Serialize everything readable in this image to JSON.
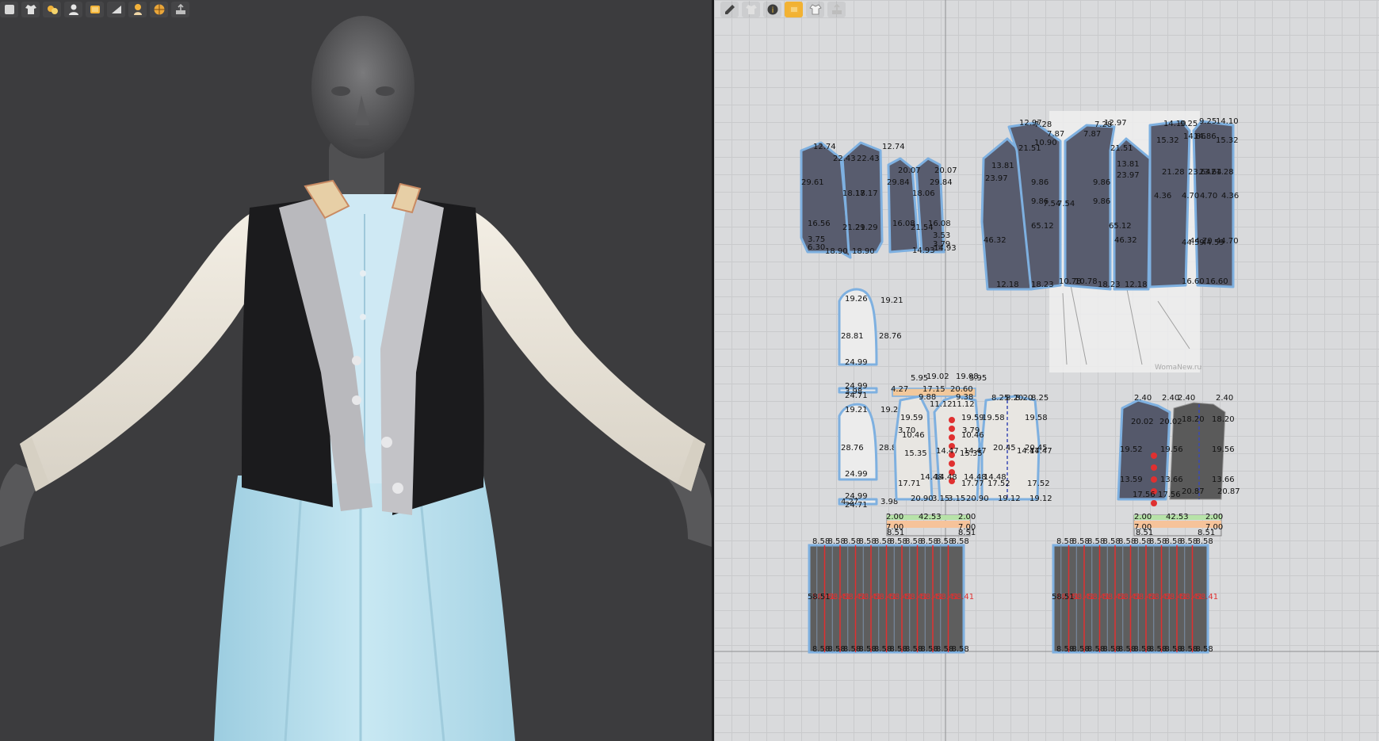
{
  "left_toolbar": {
    "icons": [
      "avatar-frame-icon",
      "garment-icon",
      "fabric-swatch-icon",
      "avatar-icon",
      "texture-icon",
      "fold-icon",
      "figure-icon",
      "globe-icon",
      "export-icon"
    ]
  },
  "right_toolbar": {
    "icons": [
      "edit-pattern-icon",
      "garment-icon",
      "pattern-info-icon",
      "texture-icon",
      "shirt-icon",
      "export-icon"
    ],
    "active_index": 3
  },
  "colors": {
    "viewport_bg": "#3c3c3e",
    "pattern_bg": "#d9dadc",
    "vest_fill": "#585c6e",
    "vest_outline": "#7eb0e0",
    "shirt_fill": "#e8e6e2",
    "skirt_fill": "#5e5e5e",
    "seam_red": "#e03030",
    "skirt_3d": "#bfe2ef",
    "sleeve_3d": "#ece7dc",
    "vest_3d": "#1c1c1e"
  },
  "patterns": {
    "back_vest_labels": [
      {
        "text": "12.74"
      },
      {
        "text": "12.74"
      },
      {
        "text": "22.43"
      },
      {
        "text": "22.43"
      },
      {
        "text": "29.61"
      },
      {
        "text": "18.17"
      },
      {
        "text": "18.17"
      },
      {
        "text": "16.56"
      },
      {
        "text": "21.29"
      },
      {
        "text": "21.29"
      },
      {
        "text": "3.75"
      },
      {
        "text": "6.30"
      },
      {
        "text": "18.90"
      },
      {
        "text": "18.90"
      },
      {
        "text": "20.07"
      },
      {
        "text": "20.07"
      },
      {
        "text": "29.84"
      },
      {
        "text": "29.84"
      },
      {
        "text": "18.06"
      },
      {
        "text": "16.08"
      },
      {
        "text": "16.08"
      },
      {
        "text": "21.54"
      },
      {
        "text": "3.53"
      },
      {
        "text": "3.79"
      },
      {
        "text": "14.93"
      },
      {
        "text": "14.93"
      }
    ],
    "front_vest_labels": [
      {
        "text": "12.97"
      },
      {
        "text": "7.28"
      },
      {
        "text": "7.87"
      },
      {
        "text": "10.90"
      },
      {
        "text": "7.87"
      },
      {
        "text": "7.28"
      },
      {
        "text": "12.97"
      },
      {
        "text": "21.51"
      },
      {
        "text": "21.51"
      },
      {
        "text": "13.81"
      },
      {
        "text": "13.81"
      },
      {
        "text": "23.97"
      },
      {
        "text": "23.97"
      },
      {
        "text": "9.86"
      },
      {
        "text": "9.86"
      },
      {
        "text": "9.86"
      },
      {
        "text": "9.86"
      },
      {
        "text": "7.54"
      },
      {
        "text": "7.54"
      },
      {
        "text": "65.12"
      },
      {
        "text": "65.12"
      },
      {
        "text": "46.32"
      },
      {
        "text": "46.32"
      },
      {
        "text": "12.18"
      },
      {
        "text": "18.23"
      },
      {
        "text": "10.78"
      },
      {
        "text": "10.78"
      },
      {
        "text": "18.23"
      },
      {
        "text": "12.18"
      }
    ],
    "side_vest_labels": [
      {
        "text": "14.10"
      },
      {
        "text": "9.25"
      },
      {
        "text": "9.25"
      },
      {
        "text": "14.10"
      },
      {
        "text": "15.32"
      },
      {
        "text": "14.86"
      },
      {
        "text": "14.86"
      },
      {
        "text": "15.32"
      },
      {
        "text": "23.64"
      },
      {
        "text": "23.64"
      },
      {
        "text": "21.28"
      },
      {
        "text": "21.28"
      },
      {
        "text": "4.36"
      },
      {
        "text": "4.70"
      },
      {
        "text": "4.70"
      },
      {
        "text": "4.36"
      },
      {
        "text": "44.70"
      },
      {
        "text": "44.59"
      },
      {
        "text": "44.59"
      },
      {
        "text": "44.70"
      },
      {
        "text": "16.60"
      },
      {
        "text": "16.60"
      }
    ],
    "sleeve_labels": [
      {
        "text": "19.26"
      },
      {
        "text": "19.21"
      },
      {
        "text": "28.81"
      },
      {
        "text": "28.76"
      },
      {
        "text": "24.99"
      },
      {
        "text": "3.98"
      },
      {
        "text": "24.99"
      },
      {
        "text": "24.71"
      },
      {
        "text": "19.21"
      },
      {
        "text": "19.26"
      },
      {
        "text": "28.76"
      },
      {
        "text": "28.81"
      },
      {
        "text": "24.99"
      },
      {
        "text": "4.27"
      },
      {
        "text": "24.99"
      },
      {
        "text": "24.71"
      },
      {
        "text": "3.98"
      }
    ],
    "shirt_labels": [
      {
        "text": "5.95"
      },
      {
        "text": "19.02"
      },
      {
        "text": "19.08"
      },
      {
        "text": "5.95"
      },
      {
        "text": "4.27"
      },
      {
        "text": "17.15"
      },
      {
        "text": "20.60"
      },
      {
        "text": "9.88"
      },
      {
        "text": "9.38"
      },
      {
        "text": "11.12"
      },
      {
        "text": "11.12"
      },
      {
        "text": "19.59"
      },
      {
        "text": "19.59"
      },
      {
        "text": "19.58"
      },
      {
        "text": "19.58"
      },
      {
        "text": "8.25"
      },
      {
        "text": "8.25"
      },
      {
        "text": "8.20"
      },
      {
        "text": "8.20"
      },
      {
        "text": "3.70"
      },
      {
        "text": "3.79"
      },
      {
        "text": "10.46"
      },
      {
        "text": "10.46"
      },
      {
        "text": "15.35"
      },
      {
        "text": "15.35"
      },
      {
        "text": "20.45"
      },
      {
        "text": "20.45"
      },
      {
        "text": "14.47"
      },
      {
        "text": "14.47"
      },
      {
        "text": "14.47"
      },
      {
        "text": "14.47"
      },
      {
        "text": "14.48"
      },
      {
        "text": "14.48"
      },
      {
        "text": "14.48"
      },
      {
        "text": "14.48"
      },
      {
        "text": "17.71"
      },
      {
        "text": "17.77"
      },
      {
        "text": "17.52"
      },
      {
        "text": "17.52"
      },
      {
        "text": "20.90"
      },
      {
        "text": "3.15"
      },
      {
        "text": "3.15"
      },
      {
        "text": "20.90"
      },
      {
        "text": "19.12"
      },
      {
        "text": "19.12"
      },
      {
        "text": "2.00"
      },
      {
        "text": "42.53"
      },
      {
        "text": "2.00"
      },
      {
        "text": "7.00"
      },
      {
        "text": "7.00"
      },
      {
        "text": "8.51"
      },
      {
        "text": "8.51"
      }
    ],
    "lining_labels": [
      {
        "text": "2.40"
      },
      {
        "text": "2.40"
      },
      {
        "text": "2.40"
      },
      {
        "text": "2.40"
      },
      {
        "text": "20.02"
      },
      {
        "text": "20.02"
      },
      {
        "text": "18.20"
      },
      {
        "text": "18.20"
      },
      {
        "text": "19.52"
      },
      {
        "text": "19.56"
      },
      {
        "text": "19.56"
      },
      {
        "text": "13.59"
      },
      {
        "text": "13.66"
      },
      {
        "text": "13.66"
      },
      {
        "text": "17.56"
      },
      {
        "text": "17.56"
      },
      {
        "text": "20.87"
      },
      {
        "text": "20.87"
      },
      {
        "text": "2.00"
      },
      {
        "text": "42.53"
      },
      {
        "text": "2.00"
      },
      {
        "text": "7.00"
      },
      {
        "text": "7.00"
      },
      {
        "text": "8.51"
      },
      {
        "text": "8.51"
      }
    ],
    "skirt_left": {
      "top_label": "8.58",
      "edge_label": "58.51",
      "seam_label": "58.41",
      "bottom_label": "8.58",
      "panels": 10
    },
    "skirt_right": {
      "top_label": "8.58",
      "edge_label": "58.51",
      "seam_label": "58.41",
      "bottom_label": "8.58",
      "panels": 10
    },
    "watermark_text": "WomaNew.ru"
  }
}
